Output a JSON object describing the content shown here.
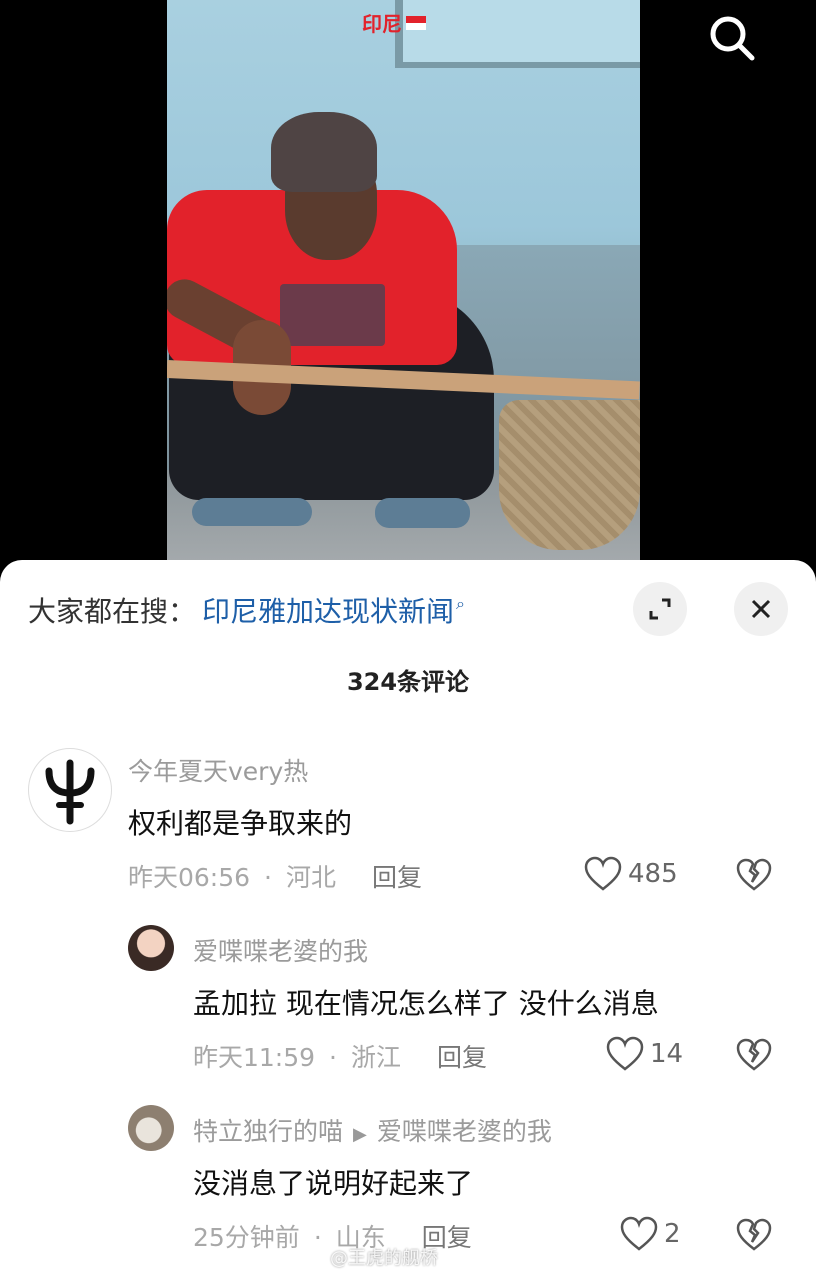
{
  "video": {
    "location_tag": "印尼"
  },
  "search_suggestion": {
    "prefix": "大家都在搜：",
    "query": "印尼雅加达现状新闻"
  },
  "comments_count": "324条评论",
  "comments": [
    {
      "user": "今年夏天very热",
      "text": "权利都是争取来的",
      "time": "昨天06:56",
      "location": "河北",
      "reply_label": "回复",
      "likes": "485"
    },
    {
      "user": "爱喋喋老婆的我",
      "text": "孟加拉 现在情况怎么样了  没什么消息",
      "time": "昨天11:59",
      "location": "浙江",
      "reply_label": "回复",
      "likes": "14"
    },
    {
      "user": "特立独行的喵",
      "reply_to": "爱喋喋老婆的我",
      "text": "没消息了说明好起来了",
      "time": "25分钟前",
      "location": "山东",
      "reply_label": "回复",
      "likes": "2"
    }
  ],
  "watermark": "@王虎的舰桥",
  "colors": {
    "link": "#1e5fa8",
    "tag_red": "#e2222b"
  }
}
